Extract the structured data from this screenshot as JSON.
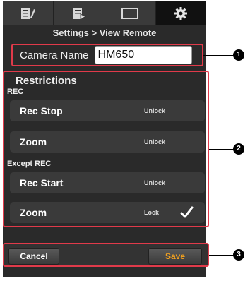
{
  "tabs": [
    {
      "icon": "list-edit-icon"
    },
    {
      "icon": "document-play-icon"
    },
    {
      "icon": "display-icon"
    },
    {
      "icon": "gear-icon"
    }
  ],
  "header": {
    "title": "Settings > View Remote"
  },
  "camera": {
    "label": "Camera Name",
    "value": "HM650"
  },
  "restrictions": {
    "title": "Restrictions",
    "sections": [
      {
        "label": "REC",
        "items": [
          {
            "name": "Rec Stop",
            "state": "Unlock",
            "checked": false
          },
          {
            "name": "Zoom",
            "state": "Unlock",
            "checked": false
          }
        ]
      },
      {
        "label": "Except REC",
        "items": [
          {
            "name": "Rec Start",
            "state": "Unlock",
            "checked": false
          },
          {
            "name": "Zoom",
            "state": "Lock",
            "checked": true
          }
        ]
      }
    ]
  },
  "footer": {
    "cancel_label": "Cancel",
    "save_label": "Save"
  },
  "callouts": [
    "1",
    "2",
    "3"
  ],
  "colors": {
    "highlight": "#e03a4a",
    "save_text": "#f0a020"
  }
}
